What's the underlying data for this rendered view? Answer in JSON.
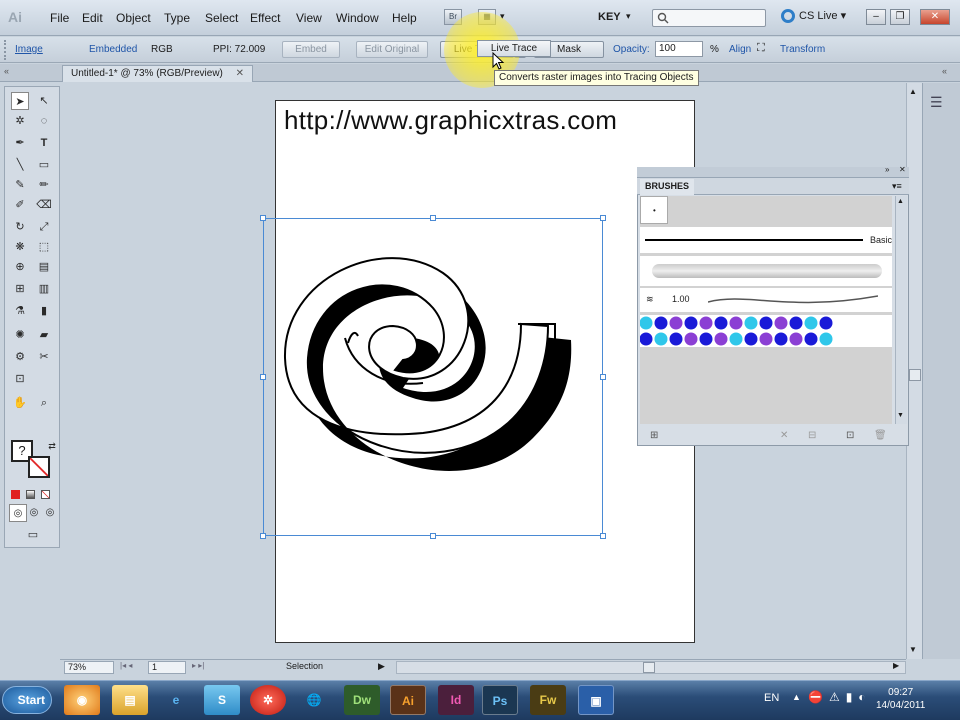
{
  "app": {
    "logo": "Ai"
  },
  "menu": [
    "File",
    "Edit",
    "Object",
    "Type",
    "Select",
    "Effect",
    "View",
    "Window",
    "Help"
  ],
  "topbar": {
    "bridge_label": "Br",
    "workspace": "KEY",
    "search_placeholder": "",
    "cslive": "CS Live"
  },
  "control_bar": {
    "object_type": "Image",
    "embedded": "Embedded",
    "color_mode": "RGB",
    "ppi": "PPI: 72.009",
    "embed_btn": "Embed",
    "edit_original_btn": "Edit Original",
    "live_trace_btn": "Live Trace",
    "mask_btn": "Mask",
    "opacity_label": "Opacity:",
    "opacity_value": "100",
    "opacity_unit": "%",
    "align": "Align",
    "transform": "Transform"
  },
  "tooltip": "Converts raster images into Tracing Objects",
  "document": {
    "tab_title": "Untitled-1* @ 73% (RGB/Preview)",
    "url_text": "http://www.graphicxtras.com"
  },
  "brushes_panel": {
    "title": "BRUSHES",
    "basic_label": "Basic",
    "brush_size": "1.00",
    "colors": {
      "cyan": "#2fc7ea",
      "blue": "#1a1ad8",
      "purple": "#8b3fd4"
    }
  },
  "status_bar": {
    "zoom": "73%",
    "page": "1",
    "mode": "Selection"
  },
  "taskbar": {
    "start": "Start",
    "apps": [
      "Dw",
      "Ai",
      "Id",
      "Ps",
      "Fw"
    ],
    "language": "EN",
    "time": "09:27",
    "date": "14/04/2011"
  }
}
